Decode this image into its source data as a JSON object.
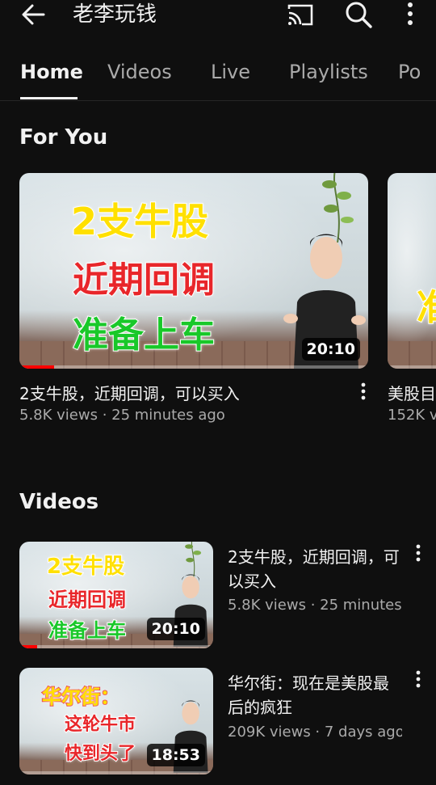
{
  "header": {
    "title": "老李玩钱"
  },
  "tabs": [
    {
      "label": "Home"
    },
    {
      "label": "Videos"
    },
    {
      "label": "Live"
    },
    {
      "label": "Playlists"
    },
    {
      "label": "Po"
    }
  ],
  "for_you": {
    "title": "For You",
    "cards": [
      {
        "thumb_lines": [
          "2支牛股",
          "近期回调",
          "准备上车"
        ],
        "duration": "20:10",
        "progress": 0.1,
        "title": "2支牛股，近期回调，可以买入",
        "meta": "5.8K views · 25 minutes ago"
      },
      {
        "thumb_lines": [
          "准"
        ],
        "title": "美股目",
        "meta": "152K v"
      }
    ]
  },
  "videos": {
    "title": "Videos",
    "items": [
      {
        "thumb_lines": [
          "2支牛股",
          "近期回调",
          "准备上车"
        ],
        "duration": "20:10",
        "progress": 0.09,
        "title": "2支牛股，近期回调，可以买入",
        "meta": "5.8K views · 25 minutes a"
      },
      {
        "thumb_lines": [
          "华尔街：",
          "这轮牛市",
          "快到头了"
        ],
        "duration": "18:53",
        "progress": 0,
        "title": "华尔街：现在是美股最后的疯狂",
        "meta": "209K views · 7 days ago"
      }
    ]
  },
  "colors": {
    "background": "#0f0f0f",
    "text_primary": "#f1f1f1",
    "text_secondary": "#aaaaaa",
    "progress": "#ff0000",
    "thumb_yellow": "#ffe000",
    "thumb_red": "#e8262a",
    "thumb_green": "#19c829"
  },
  "icons": [
    "back-arrow-icon",
    "cast-icon",
    "search-icon",
    "more-vert-icon"
  ]
}
